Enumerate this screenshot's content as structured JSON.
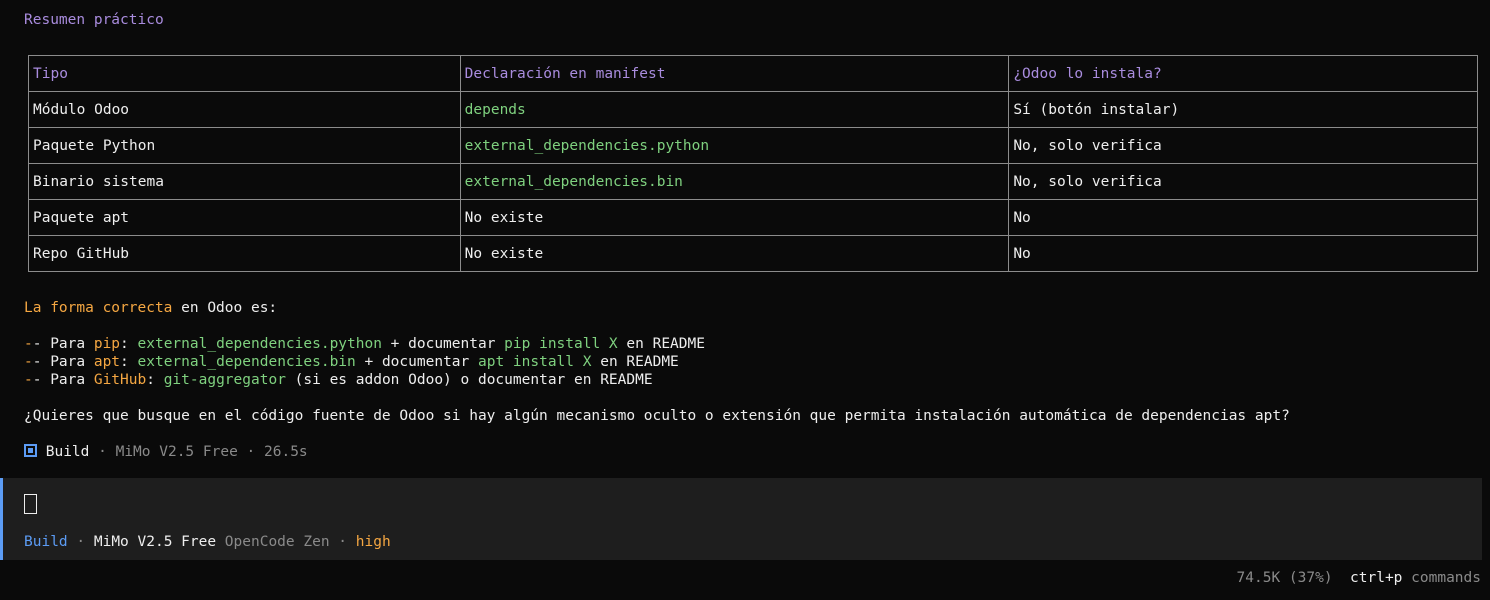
{
  "section_title": "Resumen práctico",
  "table": {
    "headers": [
      "Tipo",
      "Declaración en manifest",
      "¿Odoo lo instala?"
    ],
    "rows": [
      {
        "tipo": "Módulo Odoo",
        "decl": "depends",
        "instala": "Sí (botón instalar)"
      },
      {
        "tipo": "Paquete Python",
        "decl": "external_dependencies.python",
        "instala": "No, solo verifica"
      },
      {
        "tipo": "Binario sistema",
        "decl": "external_dependencies.bin",
        "instala": "No, solo verifica"
      },
      {
        "tipo": "Paquete apt",
        "decl": "No existe",
        "instala": "No"
      },
      {
        "tipo": "Repo GitHub",
        "decl": "No existe",
        "instala": "No"
      }
    ]
  },
  "intro": {
    "highlight": "La forma correcta",
    "rest": " en Odoo es:"
  },
  "bullets": [
    {
      "prefix": "- Para ",
      "key": "pip",
      "colon": ": ",
      "code": "external_dependencies.python",
      "mid": " + documentar ",
      "cmd": "pip install X",
      "tail": " en README"
    },
    {
      "prefix": "- Para ",
      "key": "apt",
      "colon": ": ",
      "code": "external_dependencies.bin",
      "mid": " + documentar ",
      "cmd": "apt install X",
      "tail": " en README"
    },
    {
      "prefix": "- Para ",
      "key": "GitHub",
      "colon": ": ",
      "code": "git-aggregator",
      "mid": " (si es addon Odoo) o documentar en README",
      "cmd": "",
      "tail": ""
    }
  ],
  "question": "¿Quieres que busque en el código fuente de Odoo si hay algún mecanismo oculto o extensión que permita instalación automática de dependencias apt?",
  "build_info": {
    "label": "Build",
    "sep1": " · ",
    "model": "MiMo V2.5 Free",
    "sep2": " · ",
    "time": "26.5s"
  },
  "input_status": {
    "mode": "Build",
    "sep1": " · ",
    "model": "MiMo V2.5 Free",
    "provider": " OpenCode Zen",
    "sep2": " · ",
    "effort": "high"
  },
  "footer": {
    "tokens": "74.5K (37%)",
    "shortcut": "ctrl+p",
    "shortcut_label": "commands"
  },
  "colors": {
    "accent_blue": "#5c9cf5",
    "heading_purple": "#a98cde",
    "code_green": "#7fd17f",
    "highlight_orange": "#f5a742",
    "background": "#0a0a0a",
    "panel": "#1e1e1e"
  }
}
